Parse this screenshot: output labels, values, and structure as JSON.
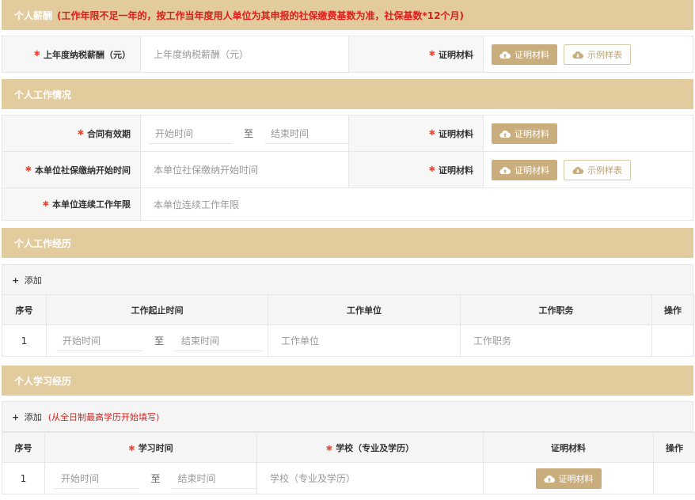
{
  "salary": {
    "title": "个人薪酬",
    "note": "(工作年限不足一年的，按工作当年度用人单位为其申报的社保缴费基数为准，社保基数*12个月)",
    "field_label": "上年度纳税薪酬（元）",
    "field_placeholder": "上年度纳税薪酬（元）",
    "proof_label": "证明材料",
    "proof_button": "证明材料",
    "sample_button": "示例样表"
  },
  "work_status": {
    "title": "个人工作情况",
    "contract_label": "合同有效期",
    "start_placeholder": "开始时间",
    "to": "至",
    "end_placeholder": "结束时间",
    "proof_label": "证明材料",
    "proof_button": "证明材料",
    "social_label": "本单位社保缴纳开始时间",
    "social_placeholder": "本单位社保缴纳开始时间",
    "proof_label_2": "证明材料",
    "proof_button_2": "证明材料",
    "sample_button": "示例样表",
    "years_label": "本单位连续工作年限",
    "years_placeholder": "本单位连续工作年限"
  },
  "work_history": {
    "title": "个人工作经历",
    "add": "添加",
    "columns": [
      "序号",
      "工作起止时间",
      "工作单位",
      "工作职务",
      "操作"
    ],
    "rows": [
      {
        "index": "1",
        "start": "开始时间",
        "to": "至",
        "end": "结束时间",
        "company": "工作单位",
        "position": "工作职务"
      }
    ]
  },
  "education": {
    "title": "个人学习经历",
    "add": "添加",
    "tip": "(从全日制最高学历开始填写)",
    "columns": [
      "序号",
      "学习时间",
      "学校（专业及学历）",
      "证明材料",
      "操作"
    ],
    "rows": [
      {
        "index": "1",
        "start": "开始时间",
        "to": "至",
        "end": "结束时间",
        "school": "学校（专业及学历）",
        "proof_button": "证明材料"
      }
    ]
  },
  "colors": {
    "header_bg": "#e2cb9c",
    "button_gold": "#c9ad7d",
    "required_star": "#e74c3c",
    "note_red": "#d9201c"
  }
}
